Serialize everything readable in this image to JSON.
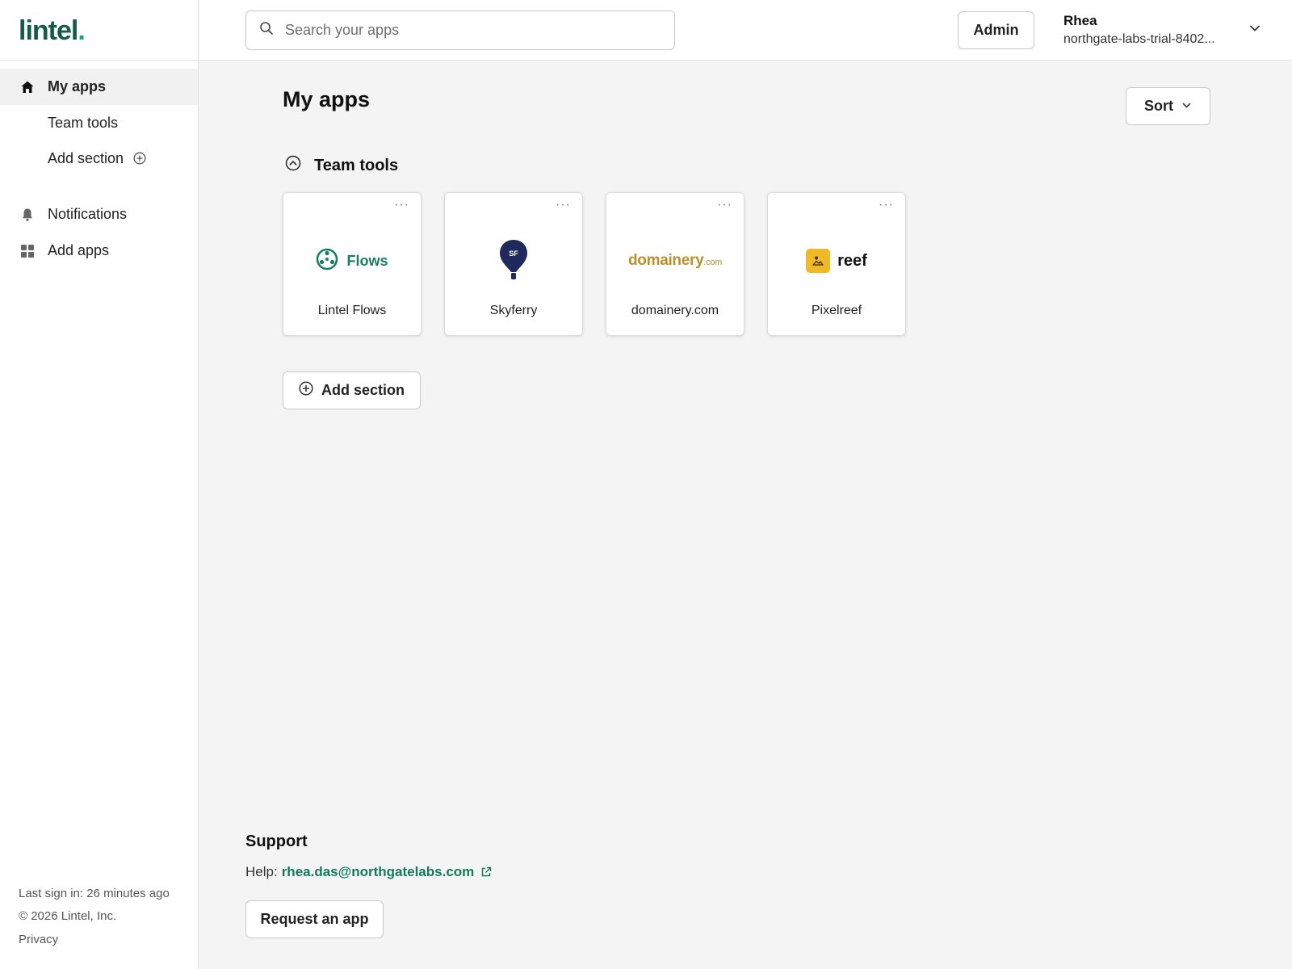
{
  "brand": {
    "name": "lintel",
    "dot": ".",
    "accent": "#145c46"
  },
  "sidebar": {
    "items": [
      {
        "label": "My apps",
        "icon": "home-icon",
        "active": true
      },
      {
        "label": "Team tools"
      },
      {
        "label": "Add section",
        "icon": "plus-circle-icon"
      },
      {
        "label": "Notifications",
        "icon": "bell-icon"
      },
      {
        "label": "Add apps",
        "icon": "grid-icon"
      }
    ],
    "footer": {
      "last_sign_in": "Last sign in: 26 minutes ago",
      "copyright": "© 2026 Lintel, Inc.",
      "privacy": "Privacy"
    }
  },
  "topbar": {
    "search_placeholder": "Search your apps",
    "admin_label": "Admin",
    "user": {
      "name": "Rhea",
      "org": "northgate-labs-trial-8402..."
    }
  },
  "main": {
    "title": "My apps",
    "sort_label": "Sort",
    "section": {
      "title": "Team tools"
    },
    "apps": [
      {
        "name": "Lintel Flows",
        "logo_text": "Flows",
        "color": "#1a7f5f"
      },
      {
        "name": "Skyferry",
        "logo_text": "SF",
        "color": "#1f2a5c"
      },
      {
        "name": "domainery.com",
        "logo_text": "domainery",
        "logo_suffix": ".com",
        "color": "#b8912a"
      },
      {
        "name": "Pixelreef",
        "logo_text": "reef",
        "color": "#f0b928"
      }
    ],
    "card_more": "···",
    "add_section_label": "Add section"
  },
  "support": {
    "title": "Support",
    "help_prefix": "Help:",
    "email": "rhea.das@northgatelabs.com",
    "request_label": "Request an app"
  }
}
